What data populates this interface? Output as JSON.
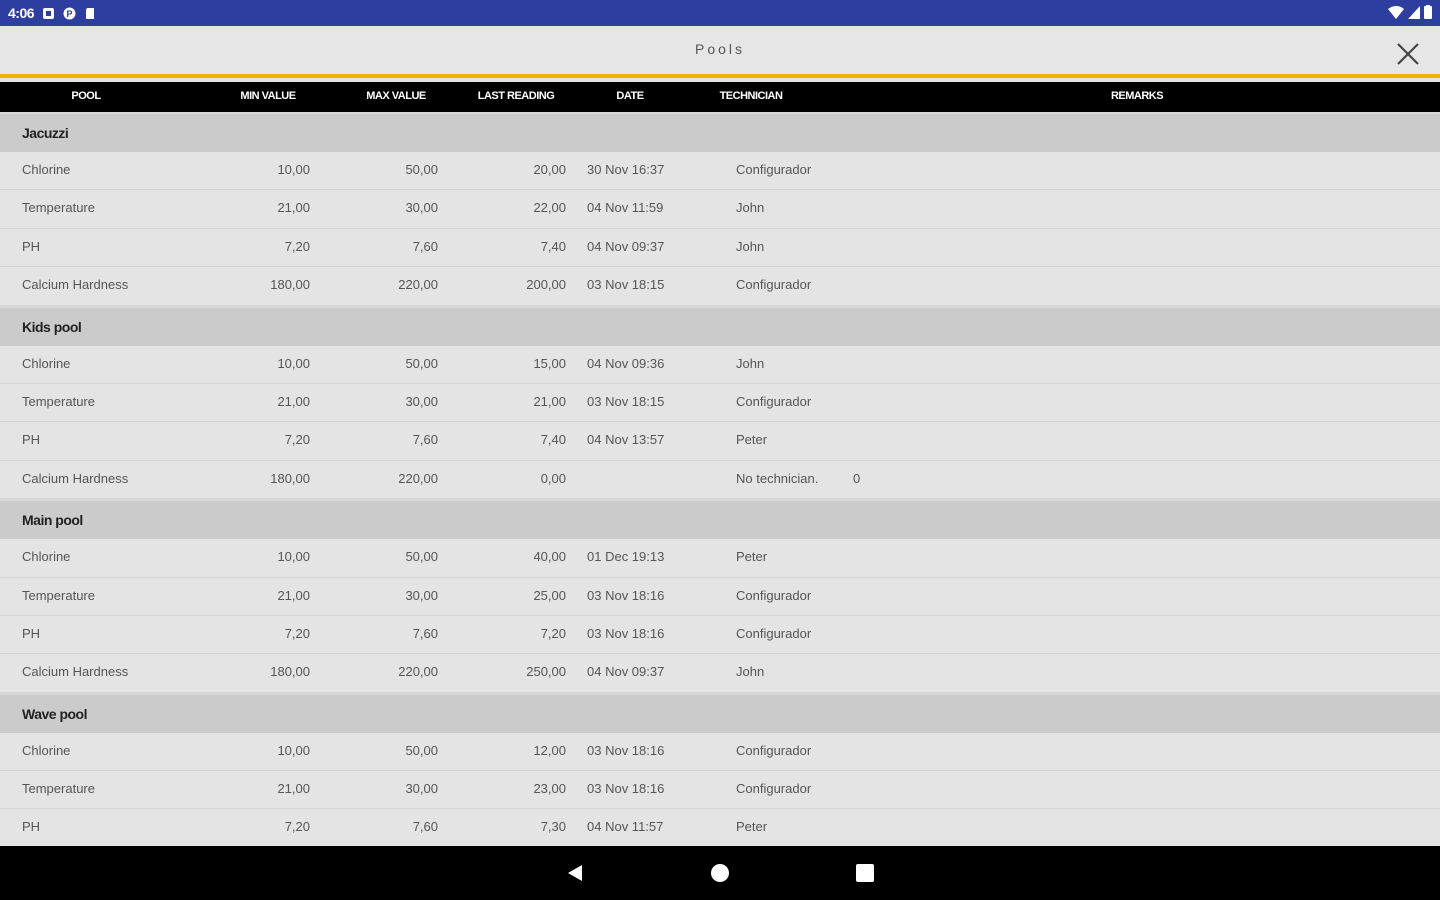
{
  "status": {
    "time": "4:06"
  },
  "appbar": {
    "title": "Pools"
  },
  "columns": [
    "POOL",
    "MIN VALUE",
    "MAX VALUE",
    "LAST READING",
    "DATE",
    "TECHNICIAN",
    "REMARKS"
  ],
  "groups": [
    {
      "name": "Jacuzzi",
      "rows": [
        {
          "name": "Chlorine",
          "min": "10,00",
          "max": "50,00",
          "last": "20,00",
          "date": "30 Nov 16:37",
          "tech": "Configurador",
          "remarks": ""
        },
        {
          "name": "Temperature",
          "min": "21,00",
          "max": "30,00",
          "last": "22,00",
          "date": "04 Nov 11:59",
          "tech": "John",
          "remarks": ""
        },
        {
          "name": "PH",
          "min": "7,20",
          "max": "7,60",
          "last": "7,40",
          "date": "04 Nov 09:37",
          "tech": "John",
          "remarks": ""
        },
        {
          "name": "Calcium Hardness",
          "min": "180,00",
          "max": "220,00",
          "last": "200,00",
          "date": "03 Nov 18:15",
          "tech": "Configurador",
          "remarks": ""
        }
      ]
    },
    {
      "name": "Kids pool",
      "rows": [
        {
          "name": "Chlorine",
          "min": "10,00",
          "max": "50,00",
          "last": "15,00",
          "date": "04 Nov 09:36",
          "tech": "John",
          "remarks": ""
        },
        {
          "name": "Temperature",
          "min": "21,00",
          "max": "30,00",
          "last": "21,00",
          "date": "03 Nov 18:15",
          "tech": "Configurador",
          "remarks": ""
        },
        {
          "name": "PH",
          "min": "7,20",
          "max": "7,60",
          "last": "7,40",
          "date": "04 Nov 13:57",
          "tech": "Peter",
          "remarks": ""
        },
        {
          "name": "Calcium Hardness",
          "min": "180,00",
          "max": "220,00",
          "last": "0,00",
          "date": "",
          "tech": "No technician.",
          "remarks": "0"
        }
      ]
    },
    {
      "name": "Main pool",
      "rows": [
        {
          "name": "Chlorine",
          "min": "10,00",
          "max": "50,00",
          "last": "40,00",
          "date": "01 Dec 19:13",
          "tech": "Peter",
          "remarks": ""
        },
        {
          "name": "Temperature",
          "min": "21,00",
          "max": "30,00",
          "last": "25,00",
          "date": "03 Nov 18:16",
          "tech": "Configurador",
          "remarks": ""
        },
        {
          "name": "PH",
          "min": "7,20",
          "max": "7,60",
          "last": "7,20",
          "date": "03 Nov 18:16",
          "tech": "Configurador",
          "remarks": ""
        },
        {
          "name": "Calcium Hardness",
          "min": "180,00",
          "max": "220,00",
          "last": "250,00",
          "date": "04 Nov 09:37",
          "tech": "John",
          "remarks": ""
        }
      ]
    },
    {
      "name": "Wave pool",
      "rows": [
        {
          "name": "Chlorine",
          "min": "10,00",
          "max": "50,00",
          "last": "12,00",
          "date": "03 Nov 18:16",
          "tech": "Configurador",
          "remarks": ""
        },
        {
          "name": "Temperature",
          "min": "21,00",
          "max": "30,00",
          "last": "23,00",
          "date": "03 Nov 18:16",
          "tech": "Configurador",
          "remarks": ""
        },
        {
          "name": "PH",
          "min": "7,20",
          "max": "7,60",
          "last": "7,30",
          "date": "04 Nov 11:57",
          "tech": "Peter",
          "remarks": ""
        }
      ]
    }
  ],
  "icons": {
    "close": "close-icon",
    "nav_back": "back-icon",
    "nav_home": "home-icon",
    "nav_recents": "recents-icon"
  },
  "colors": {
    "statusbar": "#2e3ea0",
    "accent": "#f2b400",
    "header": "#000000"
  }
}
